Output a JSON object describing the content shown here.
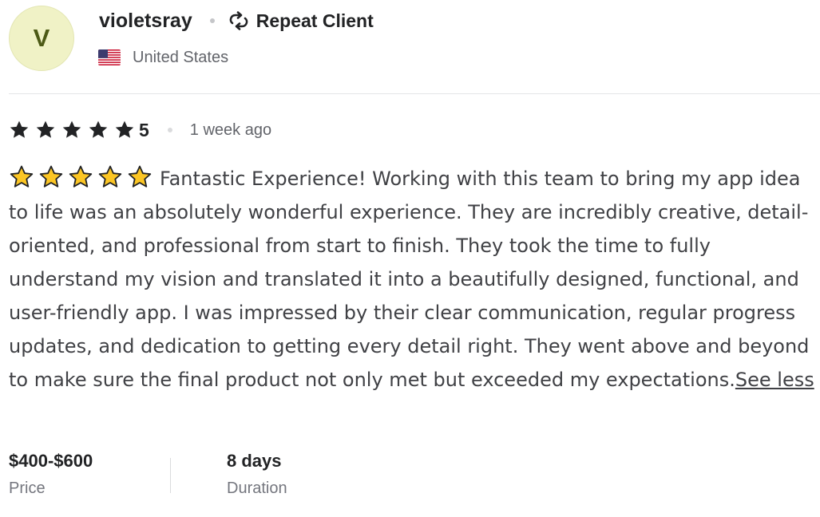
{
  "reviewer": {
    "avatar_initial": "V",
    "username": "violetsray",
    "badge_icon": "repeat-icon",
    "badge_label": "Repeat Client",
    "country_flag": "us-flag-icon",
    "country": "United States"
  },
  "rating": {
    "stars": 5,
    "value": "5",
    "time_ago": "1 week ago"
  },
  "review": {
    "emoji_stars": 5,
    "text": "Fantastic Experience! Working with this team to bring my app idea to life was an absolutely wonderful experience. They are incredibly creative, detail-oriented, and professional from start to finish. They took the time to fully understand my vision and translated it into a beautifully designed, functional, and user-friendly app. I was impressed by their clear communication, regular progress updates, and dedication to getting every detail right. They went above and beyond to make sure the final product not only met but exceeded my expectations.",
    "toggle_label": "See less"
  },
  "stats": {
    "price_value": "$400-$600",
    "price_label": "Price",
    "duration_value": "8 days",
    "duration_label": "Duration"
  },
  "colors": {
    "avatar_bg": "#f0f2c6",
    "avatar_text": "#4d5a16",
    "rating_star": "#222325",
    "emoji_star_fill": "#fcc624",
    "emoji_star_stroke": "#222325"
  }
}
